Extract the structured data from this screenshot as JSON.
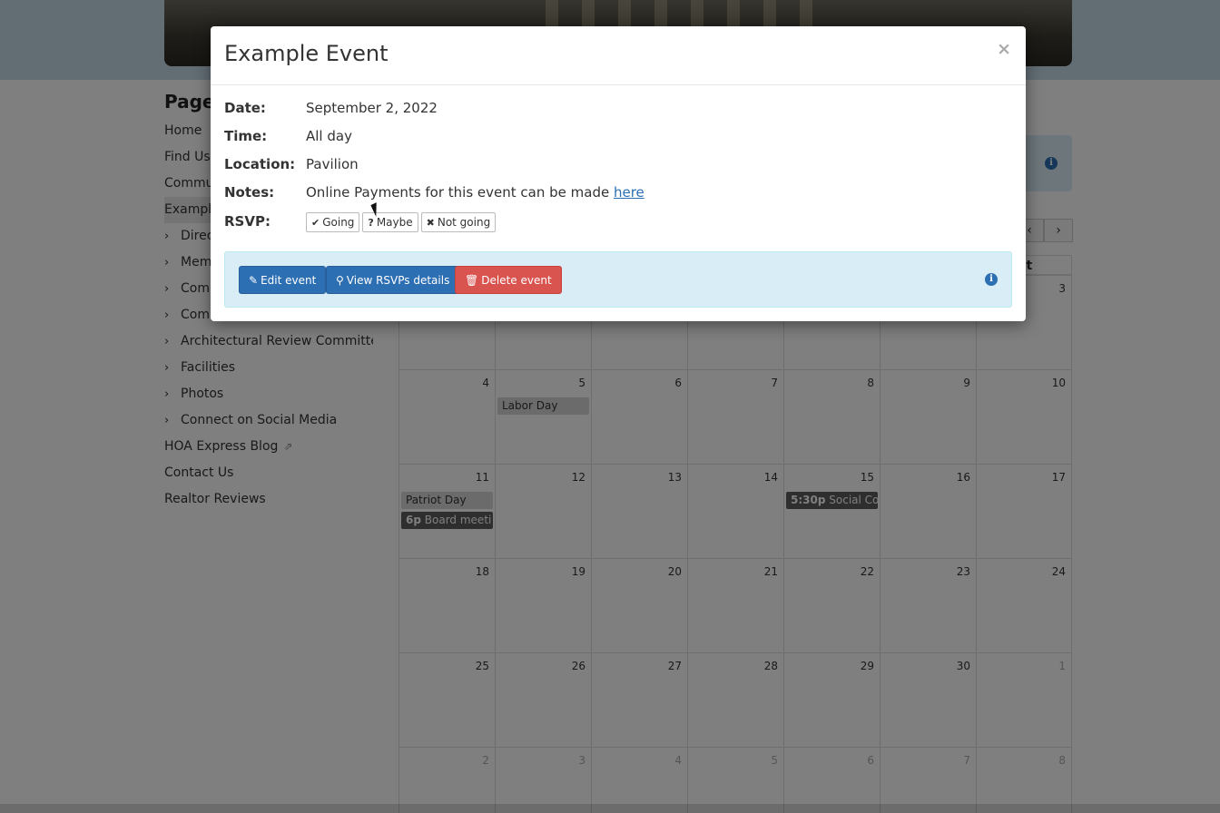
{
  "sidebar": {
    "title": "Pages",
    "items": [
      {
        "label": "Home",
        "chevron": false
      },
      {
        "label": "Find Us",
        "chevron": false
      },
      {
        "label": "Commun",
        "chevron": false
      },
      {
        "label": "Example",
        "chevron": false,
        "active": true
      },
      {
        "label": "Direc",
        "chevron": true
      },
      {
        "label": "Memb",
        "chevron": true
      },
      {
        "label": "Comm",
        "chevron": true
      },
      {
        "label": "Comm",
        "chevron": true
      },
      {
        "label": "Architectural Review Committee",
        "chevron": true
      },
      {
        "label": "Facilities",
        "chevron": true
      },
      {
        "label": "Photos",
        "chevron": true
      },
      {
        "label": "Connect on Social Media",
        "chevron": true
      },
      {
        "label": "HOA Express Blog",
        "chevron": false,
        "external": true
      },
      {
        "label": "Contact Us",
        "chevron": false
      },
      {
        "label": "Realtor Reviews",
        "chevron": false
      }
    ]
  },
  "calendar": {
    "nav": {
      "prev": "‹",
      "next": "›"
    },
    "header_fragment": "at",
    "weeks": [
      {
        "days": [
          {
            "n": ""
          },
          {
            "n": ""
          },
          {
            "n": ""
          },
          {
            "n": ""
          },
          {
            "n": ""
          },
          {
            "n": ""
          },
          {
            "n": "3"
          }
        ]
      },
      {
        "days": [
          {
            "n": "4"
          },
          {
            "n": "5",
            "events": [
              {
                "text": "Labor Day",
                "style": "allday"
              }
            ]
          },
          {
            "n": "6"
          },
          {
            "n": "7"
          },
          {
            "n": "8"
          },
          {
            "n": "9"
          },
          {
            "n": "10"
          }
        ]
      },
      {
        "days": [
          {
            "n": "11",
            "events": [
              {
                "text": "Patriot Day",
                "style": "allday"
              },
              {
                "time": "6p",
                "text": "Board meeti",
                "style": "dark"
              }
            ]
          },
          {
            "n": "12"
          },
          {
            "n": "13"
          },
          {
            "n": "14"
          },
          {
            "n": "15",
            "events": [
              {
                "time": "5:30p",
                "text": "Social Co",
                "style": "dark"
              }
            ]
          },
          {
            "n": "16"
          },
          {
            "n": "17"
          }
        ]
      },
      {
        "days": [
          {
            "n": "18"
          },
          {
            "n": "19"
          },
          {
            "n": "20"
          },
          {
            "n": "21"
          },
          {
            "n": "22"
          },
          {
            "n": "23"
          },
          {
            "n": "24"
          }
        ]
      },
      {
        "days": [
          {
            "n": "25"
          },
          {
            "n": "26"
          },
          {
            "n": "27"
          },
          {
            "n": "28"
          },
          {
            "n": "29"
          },
          {
            "n": "30"
          },
          {
            "n": "1",
            "other": true
          }
        ]
      },
      {
        "days": [
          {
            "n": "2",
            "other": true
          },
          {
            "n": "3",
            "other": true
          },
          {
            "n": "4",
            "other": true
          },
          {
            "n": "5",
            "other": true
          },
          {
            "n": "6",
            "other": true
          },
          {
            "n": "7",
            "other": true
          },
          {
            "n": "8",
            "other": true
          }
        ]
      }
    ]
  },
  "modal": {
    "title": "Example Event",
    "close": "×",
    "date_label": "Date:",
    "date_value": "September 2, 2022",
    "time_label": "Time:",
    "time_value": "All day",
    "location_label": "Location:",
    "location_value": "Pavilion",
    "notes_label": "Notes:",
    "notes_text": "Online Payments for this event can be made ",
    "notes_link": "here",
    "rsvp_label": "RSVP:",
    "rsvp_going": "Going",
    "rsvp_maybe": "Maybe",
    "rsvp_not_going": "Not going",
    "edit_button": "Edit event",
    "view_rsvps_button": "View RSVPs details",
    "delete_button": "Delete event"
  },
  "icons": {
    "check": "✔",
    "question": "?",
    "cross": "✖",
    "pencil": "✎",
    "search": "⚲",
    "trash": "🗑",
    "info": "i",
    "chevron": "›",
    "external": "⇗"
  },
  "colors": {
    "primary": "#2d6fb3",
    "danger": "#d9534f",
    "info_bg": "#d9edf7",
    "event_dark": "#5d5d5d",
    "event_allday": "#d6d6d6"
  }
}
